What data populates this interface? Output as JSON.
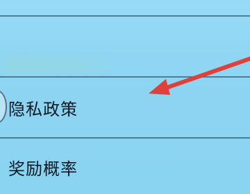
{
  "settings_list": {
    "items": [
      {
        "label": "隐私政策"
      },
      {
        "label": "奖励概率"
      }
    ]
  },
  "annotation": {
    "arrow_color": "#e0403a",
    "arrow_target": "隐私政策"
  },
  "colors": {
    "background": "#8fd6f4",
    "divider": "#4f6f86",
    "text": "#0d1a24"
  }
}
